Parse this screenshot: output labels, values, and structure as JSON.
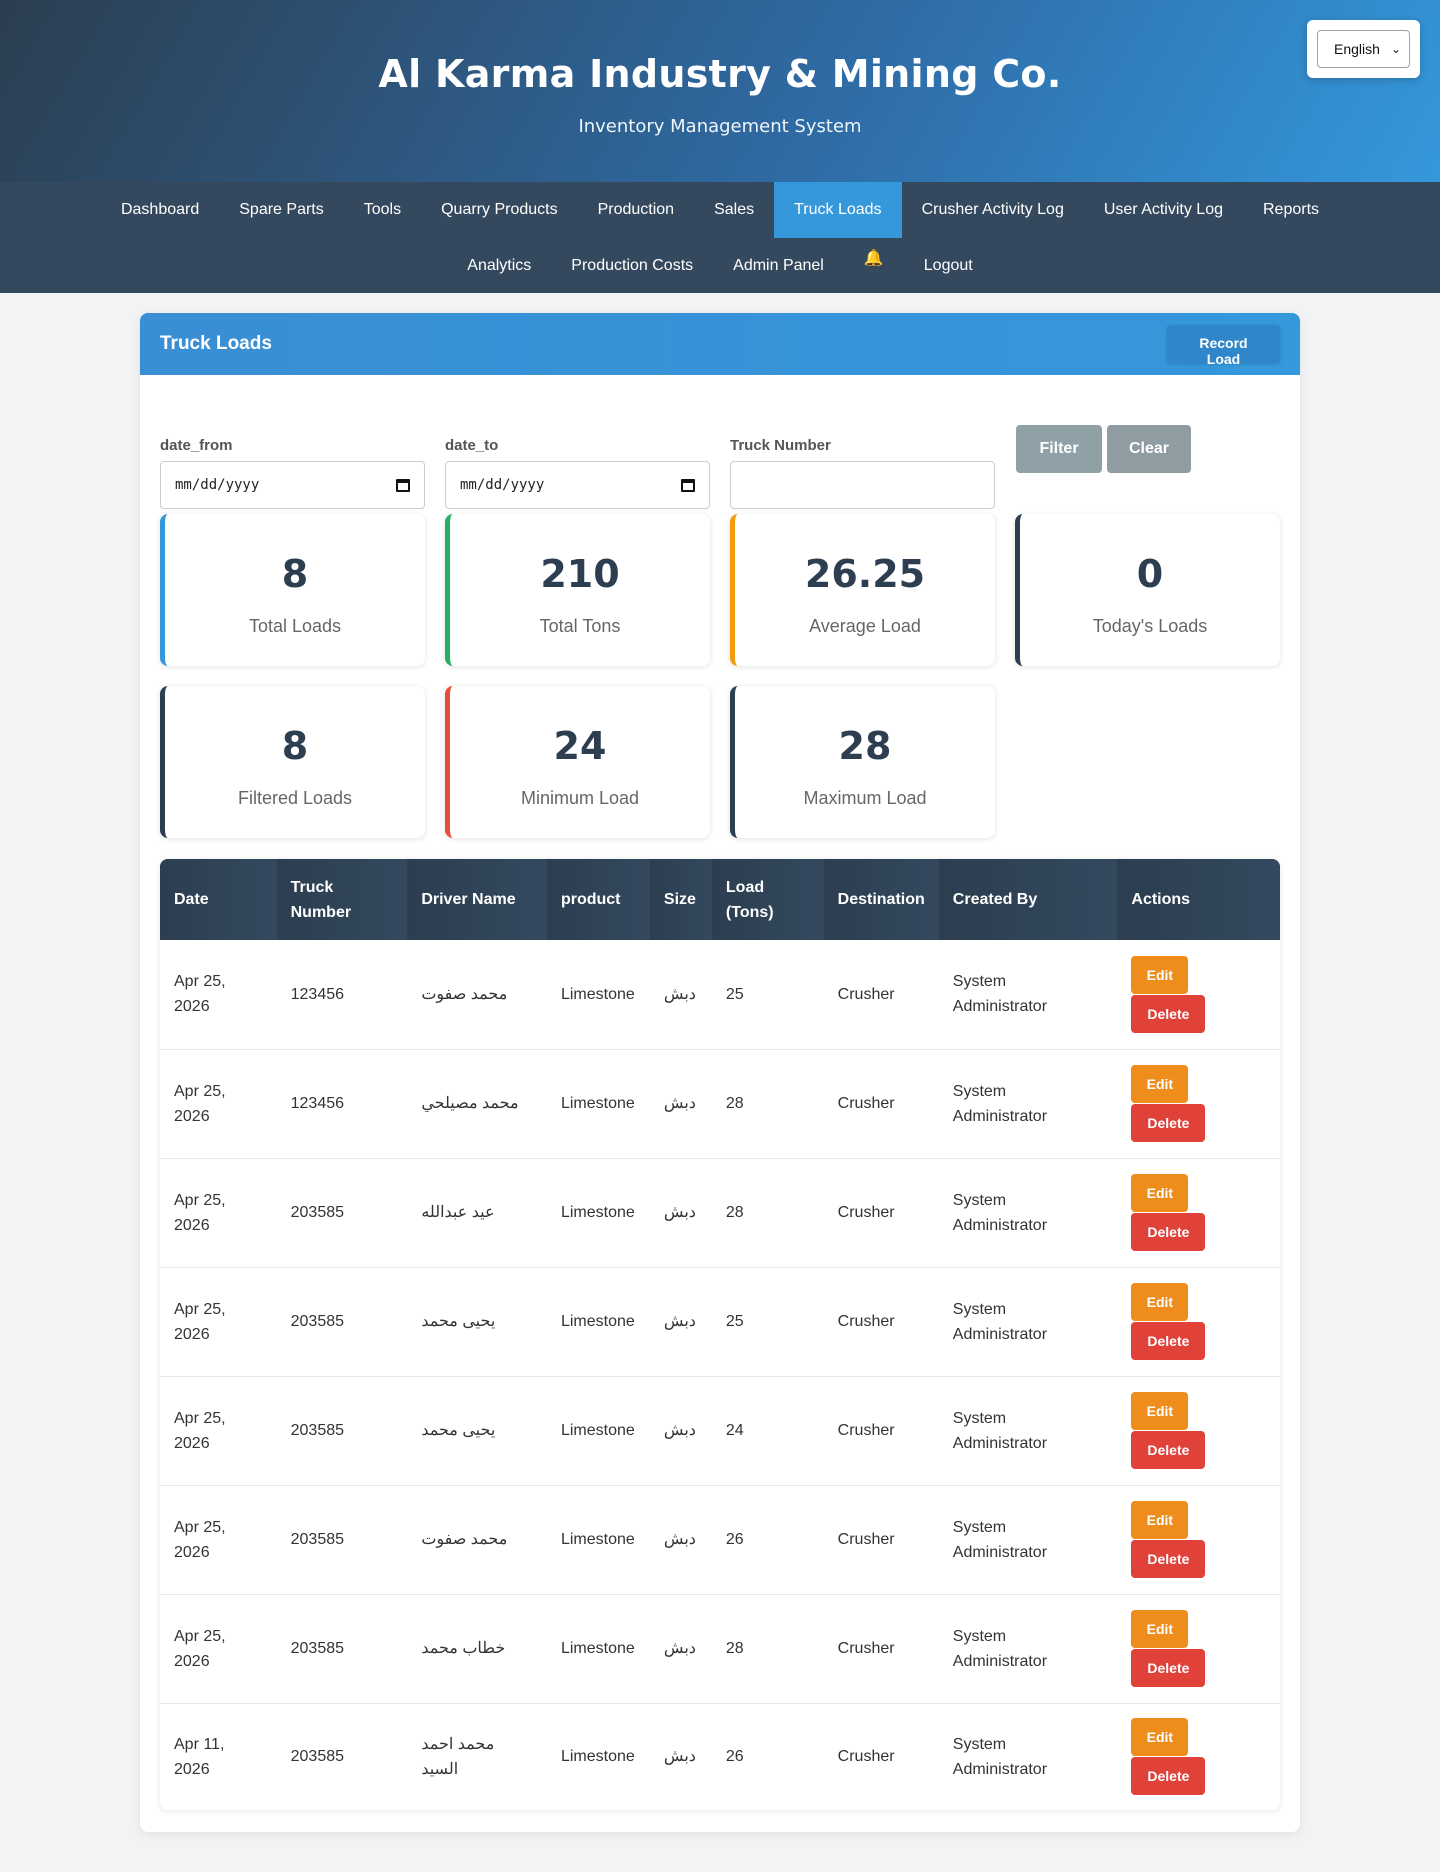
{
  "header": {
    "title": "Al Karma Industry & Mining Co.",
    "subtitle": "Inventory Management System",
    "language": "English"
  },
  "nav": {
    "row1": [
      "Dashboard",
      "Spare Parts",
      "Tools",
      "Quarry Products",
      "Production",
      "Sales",
      "Truck Loads",
      "Crusher Activity Log",
      "User Activity Log",
      "Reports",
      "Analytics"
    ],
    "row2": [
      "Production Costs",
      "Admin Panel",
      "Logout"
    ],
    "active": "Truck Loads",
    "bell_icon": "bell-icon"
  },
  "card": {
    "title": "Truck Loads",
    "record_button": "Record Load"
  },
  "filters": {
    "date_from_label": "date_from",
    "date_from_value": "mm/dd/yyyy",
    "date_to_label": "date_to",
    "date_to_value": "mm/dd/yyyy",
    "truck_label": "Truck Number",
    "truck_value": "",
    "filter_button": "Filter",
    "clear_button": "Clear"
  },
  "stats": [
    {
      "value": "8",
      "label": "Total Loads",
      "color": "#3498db"
    },
    {
      "value": "210",
      "label": "Total Tons",
      "color": "#27ae60"
    },
    {
      "value": "26.25",
      "label": "Average Load",
      "color": "#f39c12"
    },
    {
      "value": "0",
      "label": "Today's Loads",
      "color": "#2c3e50"
    },
    {
      "value": "8",
      "label": "Filtered Loads",
      "color": "#2c3e50"
    },
    {
      "value": "24",
      "label": "Minimum Load",
      "color": "#e74c3c"
    },
    {
      "value": "28",
      "label": "Maximum Load",
      "color": "#2c3e50"
    }
  ],
  "table": {
    "headers": [
      "Date",
      "Truck Number",
      "Driver Name",
      "product",
      "Size",
      "Load (Tons)",
      "Destination",
      "Created By",
      "Actions"
    ],
    "edit_label": "Edit",
    "delete_label": "Delete",
    "rows": [
      {
        "date": "Apr 25, 2026",
        "truck": "123456",
        "driver": "محمد صفوت",
        "product": "Limestone",
        "size": "دبش",
        "load": "25",
        "destination": "Crusher",
        "created_by": "System Administrator"
      },
      {
        "date": "Apr 25, 2026",
        "truck": "123456",
        "driver": "محمد مصيلحي",
        "product": "Limestone",
        "size": "دبش",
        "load": "28",
        "destination": "Crusher",
        "created_by": "System Administrator"
      },
      {
        "date": "Apr 25, 2026",
        "truck": "203585",
        "driver": "عيد عبدالله",
        "product": "Limestone",
        "size": "دبش",
        "load": "28",
        "destination": "Crusher",
        "created_by": "System Administrator"
      },
      {
        "date": "Apr 25, 2026",
        "truck": "203585",
        "driver": "يحيى محمد",
        "product": "Limestone",
        "size": "دبش",
        "load": "25",
        "destination": "Crusher",
        "created_by": "System Administrator"
      },
      {
        "date": "Apr 25, 2026",
        "truck": "203585",
        "driver": "يحيى محمد",
        "product": "Limestone",
        "size": "دبش",
        "load": "24",
        "destination": "Crusher",
        "created_by": "System Administrator"
      },
      {
        "date": "Apr 25, 2026",
        "truck": "203585",
        "driver": "محمد صفوت",
        "product": "Limestone",
        "size": "دبش",
        "load": "26",
        "destination": "Crusher",
        "created_by": "System Administrator"
      },
      {
        "date": "Apr 25, 2026",
        "truck": "203585",
        "driver": "خطاب محمد",
        "product": "Limestone",
        "size": "دبش",
        "load": "28",
        "destination": "Crusher",
        "created_by": "System Administrator"
      },
      {
        "date": "Apr 11, 2026",
        "truck": "203585",
        "driver": "محمد احمد السيد",
        "product": "Limestone",
        "size": "دبش",
        "load": "26",
        "destination": "Crusher",
        "created_by": "System Administrator"
      }
    ]
  }
}
